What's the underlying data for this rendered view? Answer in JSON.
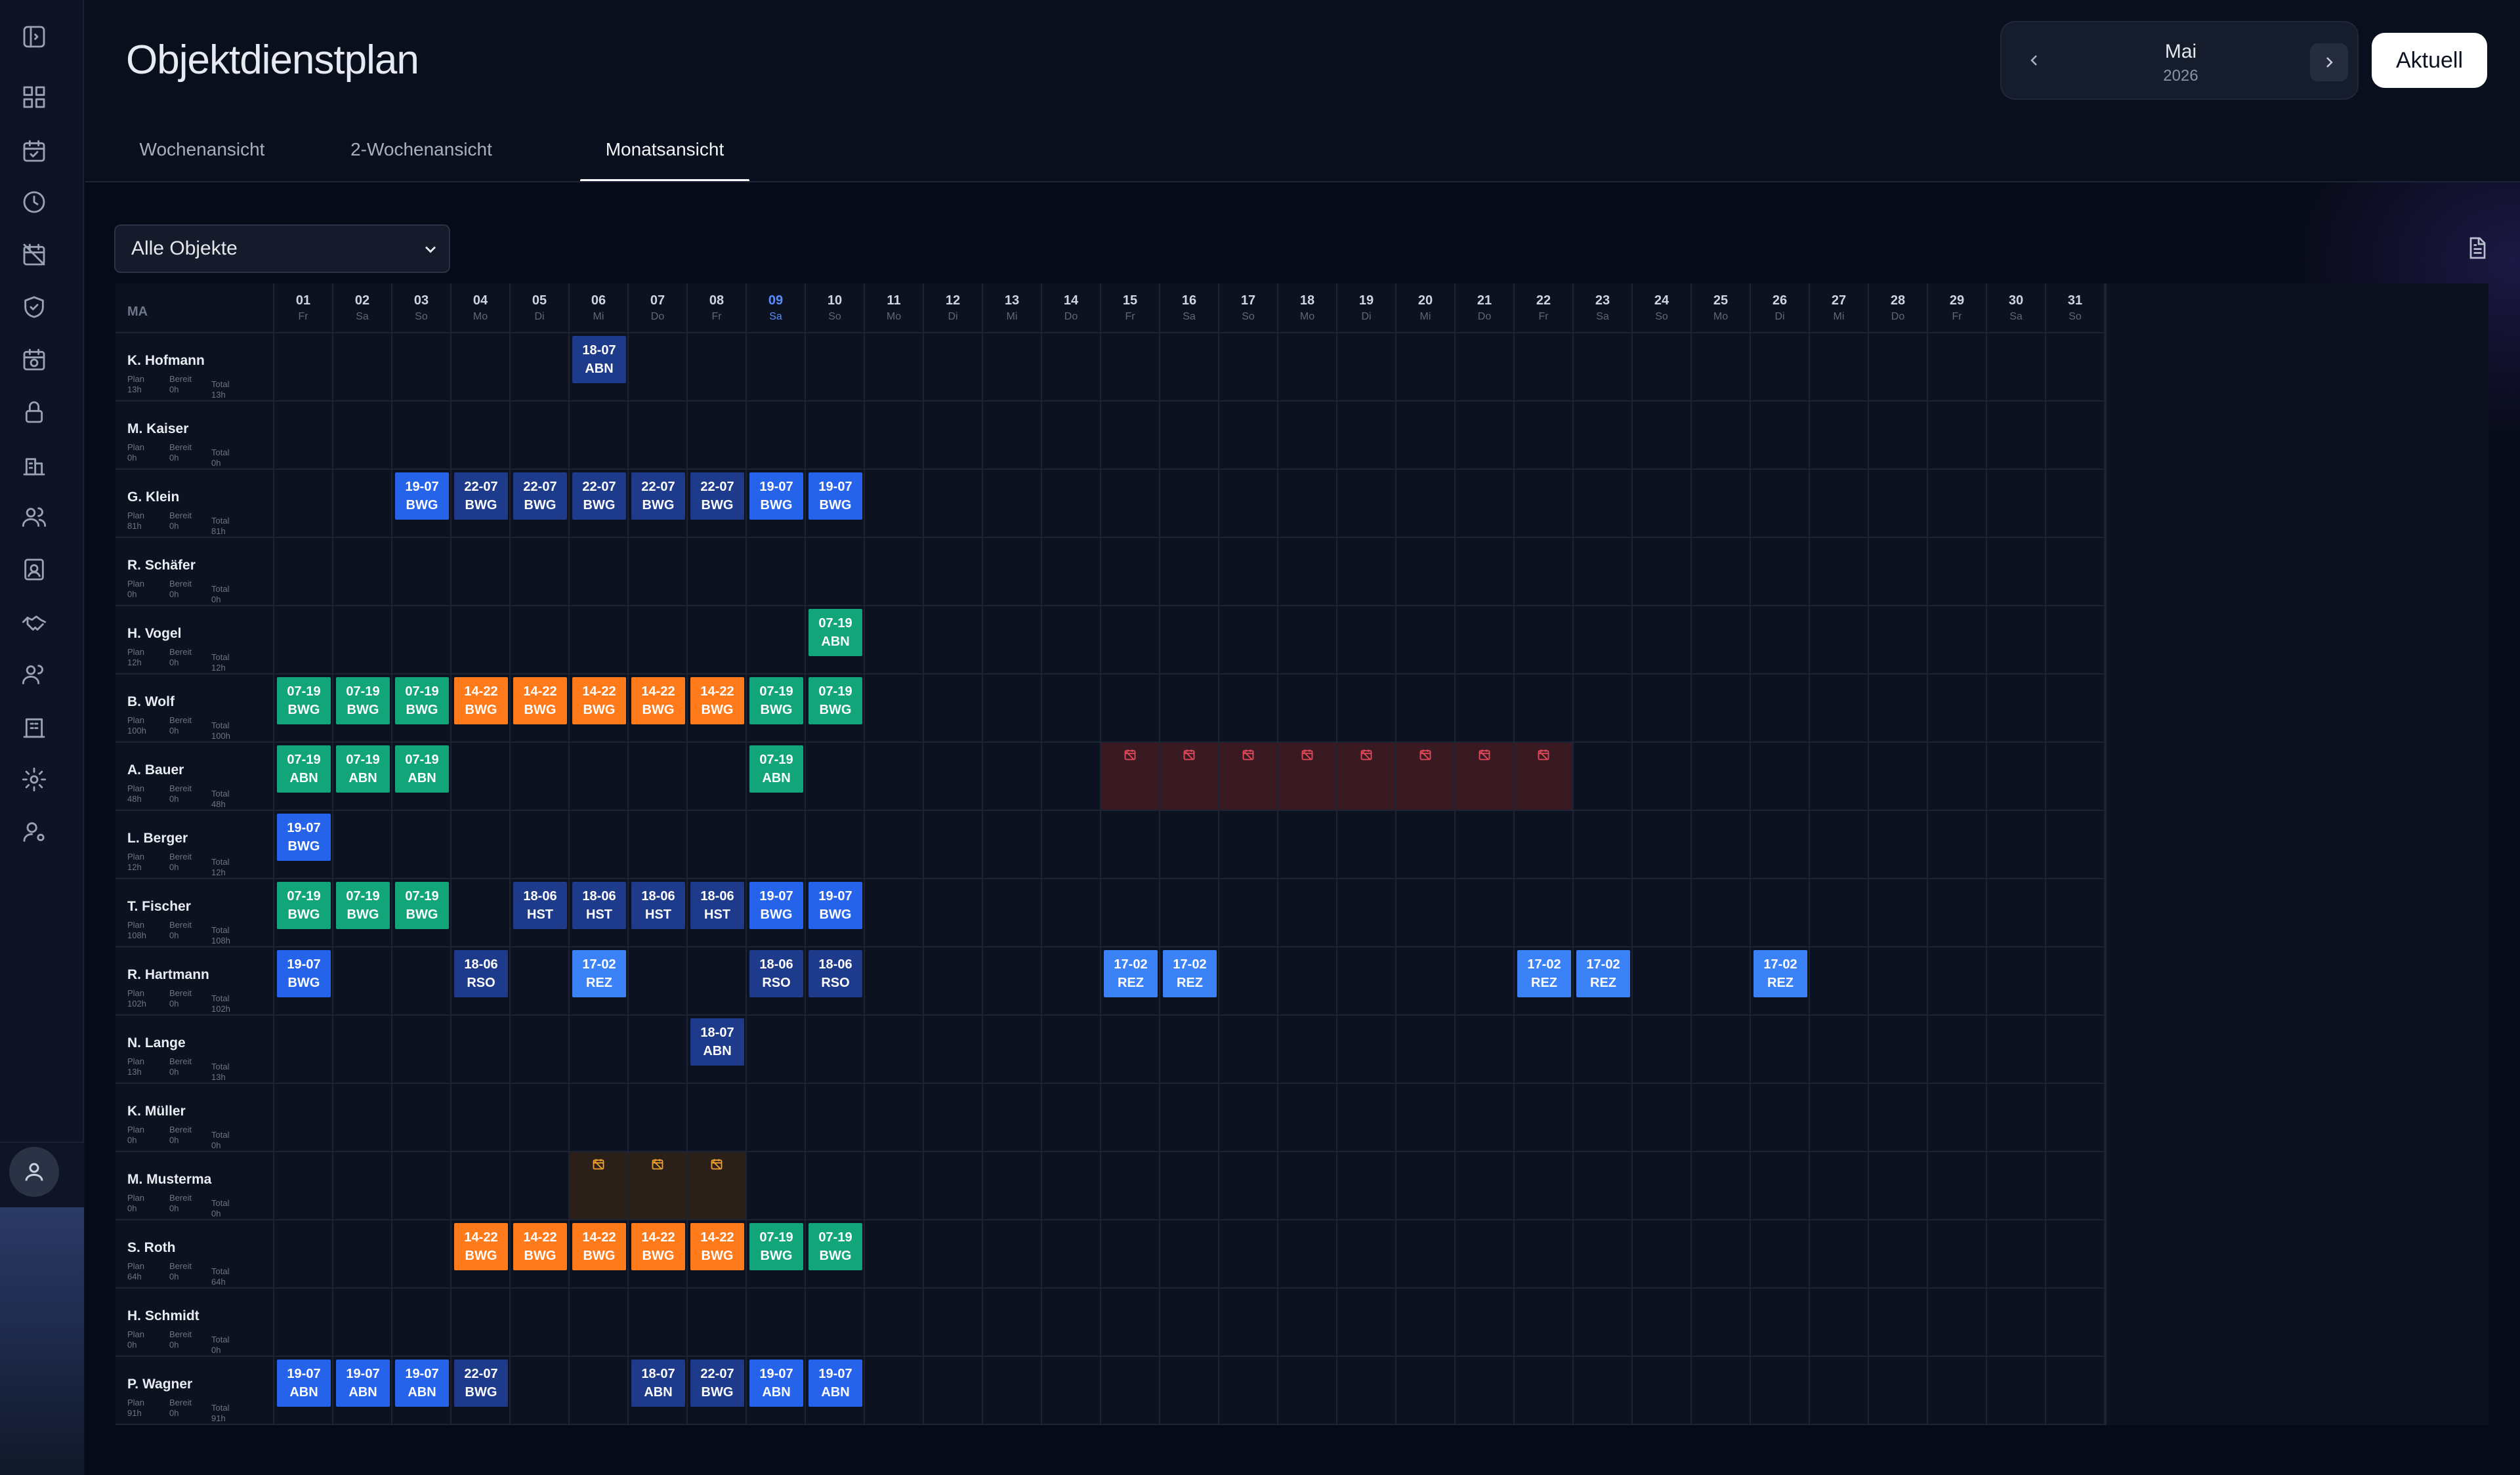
{
  "page": {
    "title": "Objektdienstplan"
  },
  "month_nav": {
    "month": "Mai",
    "year": "2026",
    "today_label": "Aktuell"
  },
  "tabs": [
    {
      "label": "Wochenansicht",
      "active": false
    },
    {
      "label": "2-Wochenansicht",
      "active": false
    },
    {
      "label": "Monatsansicht",
      "active": true
    }
  ],
  "filter": {
    "selected": "Alle Objekte"
  },
  "sidebar_icons": [
    "sidebar-toggle-icon",
    "dashboard-icon",
    "calendar-icon",
    "clock-icon",
    "calendar-off-icon",
    "shield-icon",
    "calendar-clock-icon",
    "lock-icon",
    "building-icon",
    "users-icon",
    "contact-card-icon",
    "handshake-icon",
    "team-icon",
    "office-icon",
    "gear-icon",
    "user-settings-icon"
  ],
  "colors": {
    "green": "#12a57a",
    "orange": "#ff7a1a",
    "navy": "#1e3a8a",
    "blue": "#2563eb",
    "light_blue": "#3b82f6",
    "red_block": "#3a1a22",
    "orange_block": "#2b1f1a"
  },
  "grid": {
    "first_col_label": "MA",
    "today_index": 8,
    "stat_labels": {
      "plan": "Plan",
      "bereit": "Bereit",
      "total": "Total"
    },
    "days": [
      {
        "d": "01",
        "w": "Fr"
      },
      {
        "d": "02",
        "w": "Sa"
      },
      {
        "d": "03",
        "w": "So"
      },
      {
        "d": "04",
        "w": "Mo"
      },
      {
        "d": "05",
        "w": "Di"
      },
      {
        "d": "06",
        "w": "Mi"
      },
      {
        "d": "07",
        "w": "Do"
      },
      {
        "d": "08",
        "w": "Fr"
      },
      {
        "d": "09",
        "w": "Sa"
      },
      {
        "d": "10",
        "w": "So"
      },
      {
        "d": "11",
        "w": "Mo"
      },
      {
        "d": "12",
        "w": "Di"
      },
      {
        "d": "13",
        "w": "Mi"
      },
      {
        "d": "14",
        "w": "Do"
      },
      {
        "d": "15",
        "w": "Fr"
      },
      {
        "d": "16",
        "w": "Sa"
      },
      {
        "d": "17",
        "w": "So"
      },
      {
        "d": "18",
        "w": "Mo"
      },
      {
        "d": "19",
        "w": "Di"
      },
      {
        "d": "20",
        "w": "Mi"
      },
      {
        "d": "21",
        "w": "Do"
      },
      {
        "d": "22",
        "w": "Fr"
      },
      {
        "d": "23",
        "w": "Sa"
      },
      {
        "d": "24",
        "w": "So"
      },
      {
        "d": "25",
        "w": "Mo"
      },
      {
        "d": "26",
        "w": "Di"
      },
      {
        "d": "27",
        "w": "Mi"
      },
      {
        "d": "28",
        "w": "Do"
      },
      {
        "d": "29",
        "w": "Fr"
      },
      {
        "d": "30",
        "w": "Sa"
      },
      {
        "d": "31",
        "w": "So"
      }
    ],
    "employees": [
      {
        "name": "K. Hofmann",
        "plan": "13h",
        "bereit": "0h",
        "total": "13h",
        "shifts": [
          {
            "day": 6,
            "time": "18-07",
            "code": "ABN",
            "color": "navy"
          }
        ]
      },
      {
        "name": "M. Kaiser",
        "plan": "0h",
        "bereit": "0h",
        "total": "0h",
        "shifts": []
      },
      {
        "name": "G. Klein",
        "plan": "81h",
        "bereit": "0h",
        "total": "81h",
        "shifts": [
          {
            "day": 3,
            "time": "19-07",
            "code": "BWG",
            "color": "blue"
          },
          {
            "day": 4,
            "time": "22-07",
            "code": "BWG",
            "color": "navy"
          },
          {
            "day": 5,
            "time": "22-07",
            "code": "BWG",
            "color": "navy"
          },
          {
            "day": 6,
            "time": "22-07",
            "code": "BWG",
            "color": "navy"
          },
          {
            "day": 7,
            "time": "22-07",
            "code": "BWG",
            "color": "navy"
          },
          {
            "day": 8,
            "time": "22-07",
            "code": "BWG",
            "color": "navy"
          },
          {
            "day": 9,
            "time": "19-07",
            "code": "BWG",
            "color": "blue"
          },
          {
            "day": 10,
            "time": "19-07",
            "code": "BWG",
            "color": "blue"
          }
        ]
      },
      {
        "name": "R. Schäfer",
        "plan": "0h",
        "bereit": "0h",
        "total": "0h",
        "shifts": []
      },
      {
        "name": "H. Vogel",
        "plan": "12h",
        "bereit": "0h",
        "total": "12h",
        "shifts": [
          {
            "day": 10,
            "time": "07-19",
            "code": "ABN",
            "color": "green"
          }
        ]
      },
      {
        "name": "B. Wolf",
        "plan": "100h",
        "bereit": "0h",
        "total": "100h",
        "shifts": [
          {
            "day": 1,
            "time": "07-19",
            "code": "BWG",
            "color": "green"
          },
          {
            "day": 2,
            "time": "07-19",
            "code": "BWG",
            "color": "green"
          },
          {
            "day": 3,
            "time": "07-19",
            "code": "BWG",
            "color": "green"
          },
          {
            "day": 4,
            "time": "14-22",
            "code": "BWG",
            "color": "orange"
          },
          {
            "day": 5,
            "time": "14-22",
            "code": "BWG",
            "color": "orange"
          },
          {
            "day": 6,
            "time": "14-22",
            "code": "BWG",
            "color": "orange"
          },
          {
            "day": 7,
            "time": "14-22",
            "code": "BWG",
            "color": "orange"
          },
          {
            "day": 8,
            "time": "14-22",
            "code": "BWG",
            "color": "orange"
          },
          {
            "day": 9,
            "time": "07-19",
            "code": "BWG",
            "color": "green"
          },
          {
            "day": 10,
            "time": "07-19",
            "code": "BWG",
            "color": "green"
          }
        ]
      },
      {
        "name": "A. Bauer",
        "plan": "48h",
        "bereit": "0h",
        "total": "48h",
        "shifts": [
          {
            "day": 1,
            "time": "07-19",
            "code": "ABN",
            "color": "green"
          },
          {
            "day": 2,
            "time": "07-19",
            "code": "ABN",
            "color": "green"
          },
          {
            "day": 3,
            "time": "07-19",
            "code": "ABN",
            "color": "green"
          },
          {
            "day": 9,
            "time": "07-19",
            "code": "ABN",
            "color": "green"
          }
        ],
        "blocked": {
          "from": 15,
          "to": 22,
          "type": "red"
        }
      },
      {
        "name": "L. Berger",
        "plan": "12h",
        "bereit": "0h",
        "total": "12h",
        "shifts": [
          {
            "day": 1,
            "time": "19-07",
            "code": "BWG",
            "color": "blue"
          }
        ]
      },
      {
        "name": "T. Fischer",
        "plan": "108h",
        "bereit": "0h",
        "total": "108h",
        "shifts": [
          {
            "day": 1,
            "time": "07-19",
            "code": "BWG",
            "color": "green"
          },
          {
            "day": 2,
            "time": "07-19",
            "code": "BWG",
            "color": "green"
          },
          {
            "day": 3,
            "time": "07-19",
            "code": "BWG",
            "color": "green"
          },
          {
            "day": 5,
            "time": "18-06",
            "code": "HST",
            "color": "navy"
          },
          {
            "day": 6,
            "time": "18-06",
            "code": "HST",
            "color": "navy"
          },
          {
            "day": 7,
            "time": "18-06",
            "code": "HST",
            "color": "navy"
          },
          {
            "day": 8,
            "time": "18-06",
            "code": "HST",
            "color": "navy"
          },
          {
            "day": 9,
            "time": "19-07",
            "code": "BWG",
            "color": "blue"
          },
          {
            "day": 10,
            "time": "19-07",
            "code": "BWG",
            "color": "blue"
          }
        ]
      },
      {
        "name": "R. Hartmann",
        "plan": "102h",
        "bereit": "0h",
        "total": "102h",
        "shifts": [
          {
            "day": 1,
            "time": "19-07",
            "code": "BWG",
            "color": "blue"
          },
          {
            "day": 4,
            "time": "18-06",
            "code": "RSO",
            "color": "navy"
          },
          {
            "day": 6,
            "time": "17-02",
            "code": "REZ",
            "color": "light_blue"
          },
          {
            "day": 9,
            "time": "18-06",
            "code": "RSO",
            "color": "navy"
          },
          {
            "day": 10,
            "time": "18-06",
            "code": "RSO",
            "color": "navy"
          },
          {
            "day": 15,
            "time": "17-02",
            "code": "REZ",
            "color": "light_blue"
          },
          {
            "day": 16,
            "time": "17-02",
            "code": "REZ",
            "color": "light_blue"
          },
          {
            "day": 22,
            "time": "17-02",
            "code": "REZ",
            "color": "light_blue"
          },
          {
            "day": 23,
            "time": "17-02",
            "code": "REZ",
            "color": "light_blue"
          },
          {
            "day": 26,
            "time": "17-02",
            "code": "REZ",
            "color": "light_blue"
          }
        ]
      },
      {
        "name": "N. Lange",
        "plan": "13h",
        "bereit": "0h",
        "total": "13h",
        "shifts": [
          {
            "day": 8,
            "time": "18-07",
            "code": "ABN",
            "color": "navy"
          }
        ]
      },
      {
        "name": "K. Müller",
        "plan": "0h",
        "bereit": "0h",
        "total": "0h",
        "shifts": []
      },
      {
        "name": "M. Musterma",
        "plan": "0h",
        "bereit": "0h",
        "total": "0h",
        "shifts": [],
        "blocked": {
          "from": 6,
          "to": 8,
          "type": "orange"
        }
      },
      {
        "name": "S. Roth",
        "plan": "64h",
        "bereit": "0h",
        "total": "64h",
        "shifts": [
          {
            "day": 4,
            "time": "14-22",
            "code": "BWG",
            "color": "orange"
          },
          {
            "day": 5,
            "time": "14-22",
            "code": "BWG",
            "color": "orange"
          },
          {
            "day": 6,
            "time": "14-22",
            "code": "BWG",
            "color": "orange"
          },
          {
            "day": 7,
            "time": "14-22",
            "code": "BWG",
            "color": "orange"
          },
          {
            "day": 8,
            "time": "14-22",
            "code": "BWG",
            "color": "orange"
          },
          {
            "day": 9,
            "time": "07-19",
            "code": "BWG",
            "color": "green"
          },
          {
            "day": 10,
            "time": "07-19",
            "code": "BWG",
            "color": "green"
          }
        ]
      },
      {
        "name": "H. Schmidt",
        "plan": "0h",
        "bereit": "0h",
        "total": "0h",
        "shifts": []
      },
      {
        "name": "P. Wagner",
        "plan": "91h",
        "bereit": "0h",
        "total": "91h",
        "shifts": [
          {
            "day": 1,
            "time": "19-07",
            "code": "ABN",
            "color": "blue"
          },
          {
            "day": 2,
            "time": "19-07",
            "code": "ABN",
            "color": "blue"
          },
          {
            "day": 3,
            "time": "19-07",
            "code": "ABN",
            "color": "blue"
          },
          {
            "day": 4,
            "time": "22-07",
            "code": "BWG",
            "color": "navy"
          },
          {
            "day": 7,
            "time": "18-07",
            "code": "ABN",
            "color": "navy"
          },
          {
            "day": 8,
            "time": "22-07",
            "code": "BWG",
            "color": "navy"
          },
          {
            "day": 9,
            "time": "19-07",
            "code": "ABN",
            "color": "blue"
          },
          {
            "day": 10,
            "time": "19-07",
            "code": "ABN",
            "color": "blue"
          }
        ]
      }
    ]
  }
}
